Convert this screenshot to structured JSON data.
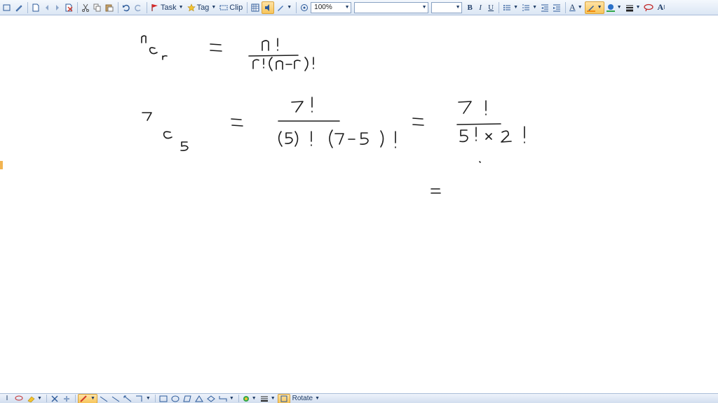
{
  "toolbar": {
    "task_label": "Task",
    "tag_label": "Tag",
    "clip_label": "Clip",
    "zoom_value": "100%",
    "font_value": "",
    "size_value": "",
    "bold_label": "B",
    "italic_label": "I",
    "underline_label": "U",
    "font_color_label": "A",
    "text_size_label": "A"
  },
  "bottom_toolbar": {
    "rotate_label": "Rotate"
  },
  "colors": {
    "toolbar_bg": "#dbe6f4",
    "accent": "#f7c55a",
    "ink": "#1b1b1b"
  }
}
